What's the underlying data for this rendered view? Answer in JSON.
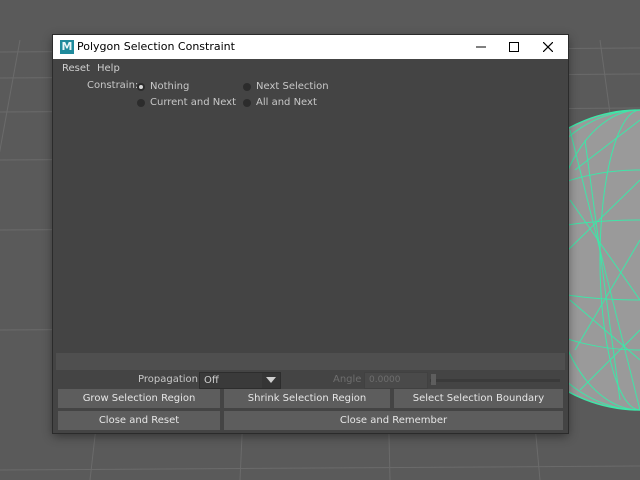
{
  "window": {
    "title": "Polygon Selection Constraint",
    "logo_letter": "M",
    "logo_color": "#1f8a9c",
    "controls": [
      "minimize-icon",
      "maximize-icon",
      "close-icon"
    ]
  },
  "menu": {
    "items": [
      {
        "label": "Reset"
      },
      {
        "label": "Help"
      }
    ]
  },
  "constrain": {
    "label": "Constrain:",
    "options": [
      {
        "label": "Nothing",
        "selected": true
      },
      {
        "label": "Next Selection",
        "selected": false
      },
      {
        "label": "Current and Next",
        "selected": false
      },
      {
        "label": "All and Next",
        "selected": false
      }
    ]
  },
  "propagation": {
    "label": "Propagation:",
    "value": "Off"
  },
  "angle": {
    "label": "Angle",
    "value": "0.0000",
    "enabled": false
  },
  "buttons": {
    "grow": "Grow Selection Region",
    "shrink": "Shrink Selection Region",
    "boundary": "Select Selection Boundary",
    "close_reset": "Close and Reset",
    "close_remember": "Close and Remember"
  },
  "colors": {
    "viewport_bg": "#5a5a5a",
    "grid_line": "#6b6b6b",
    "wireframe": "#3ee6a8",
    "panel_bg": "#444444",
    "button_bg": "#5d5d5d"
  }
}
